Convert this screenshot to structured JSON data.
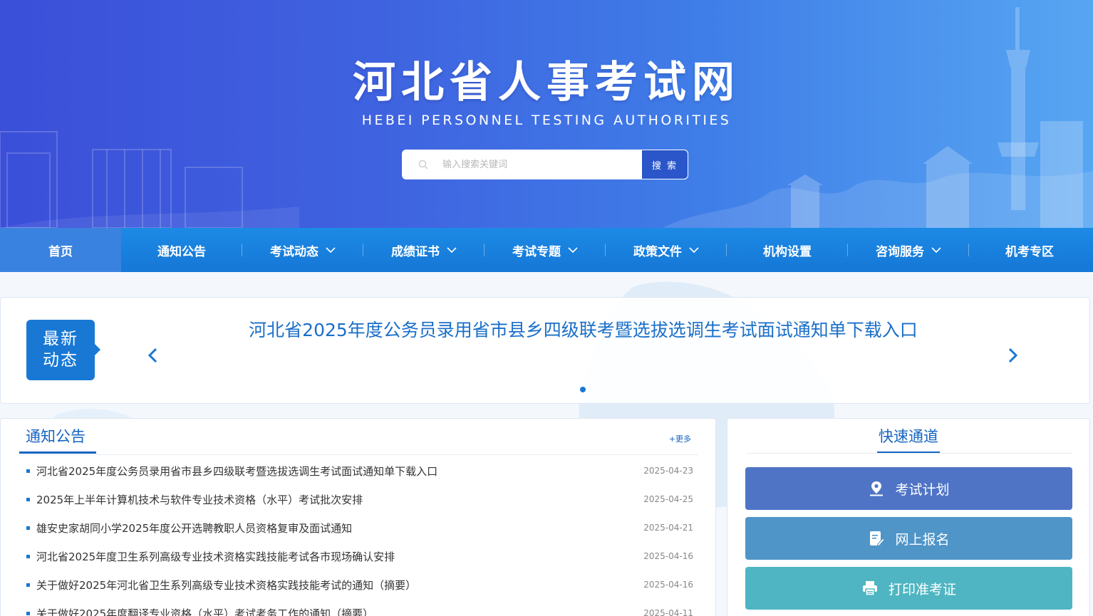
{
  "header": {
    "title": "河北省人事考试网",
    "subtitle": "HEBEI PERSONNEL TESTING AUTHORITIES"
  },
  "search": {
    "placeholder": "输入搜索关键词",
    "button_label": "搜 索",
    "icon": "search-icon"
  },
  "nav": {
    "items": [
      {
        "label": "首页",
        "dropdown": false,
        "active": true
      },
      {
        "label": "通知公告",
        "dropdown": false
      },
      {
        "label": "考试动态",
        "dropdown": true
      },
      {
        "label": "成绩证书",
        "dropdown": true
      },
      {
        "label": "考试专题",
        "dropdown": true
      },
      {
        "label": "政策文件",
        "dropdown": true
      },
      {
        "label": "机构设置",
        "dropdown": false
      },
      {
        "label": "咨询服务",
        "dropdown": true
      },
      {
        "label": "机考专区",
        "dropdown": false
      }
    ]
  },
  "latest": {
    "badge_line1": "最新",
    "badge_line2": "动态",
    "headline": "河北省2025年度公务员录用省市县乡四级联考暨选拔选调生考试面试通知单下载入口",
    "prev_icon": "chevron-left-icon",
    "next_icon": "chevron-right-icon"
  },
  "notices": {
    "title": "通知公告",
    "more_label": "+更多",
    "items": [
      {
        "title": "河北省2025年度公务员录用省市县乡四级联考暨选拔选调生考试面试通知单下载入口",
        "date": "2025-04-23"
      },
      {
        "title": "2025年上半年计算机技术与软件专业技术资格（水平）考试批次安排",
        "date": "2025-04-25"
      },
      {
        "title": "雄安史家胡同小学2025年度公开选聘教职人员资格复审及面试通知",
        "date": "2025-04-21"
      },
      {
        "title": "河北省2025年度卫生系列高级专业技术资格实践技能考试各市现场确认安排",
        "date": "2025-04-16"
      },
      {
        "title": "关于做好2025年河北省卫生系列高级专业技术资格实践技能考试的通知（摘要）",
        "date": "2025-04-16"
      },
      {
        "title": "关于做好2025年度翻译专业资格（水平）考试考务工作的通知（摘要）",
        "date": "2025-04-11"
      }
    ]
  },
  "quick": {
    "title": "快速通道",
    "buttons": [
      {
        "label": "考试计划",
        "icon": "map-pin-icon",
        "color": "#4f74c6"
      },
      {
        "label": "网上报名",
        "icon": "edit-form-icon",
        "color": "#4f95c8"
      },
      {
        "label": "打印准考证",
        "icon": "printer-icon",
        "color": "#4fb5c2"
      }
    ]
  },
  "colors": {
    "header_start": "#3b4fd8",
    "header_end": "#57a6f2",
    "nav": "#1878d4",
    "accent": "#1565c0"
  }
}
